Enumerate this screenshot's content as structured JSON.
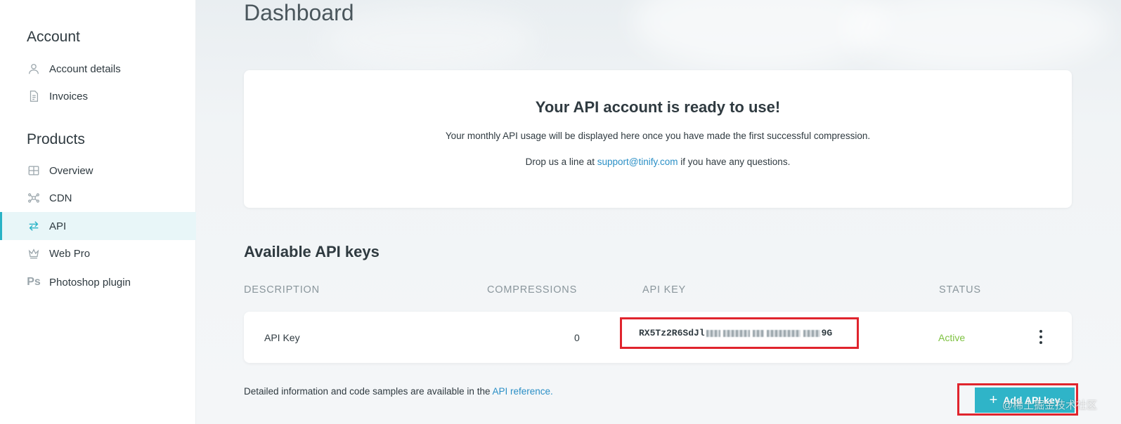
{
  "sidebar": {
    "account_heading": "Account",
    "account_items": [
      {
        "label": "Account details",
        "icon": "user-icon"
      },
      {
        "label": "Invoices",
        "icon": "document-icon"
      }
    ],
    "products_heading": "Products",
    "product_items": [
      {
        "label": "Overview",
        "icon": "grid-icon"
      },
      {
        "label": "CDN",
        "icon": "network-icon"
      },
      {
        "label": "API",
        "icon": "arrows-exchange-icon",
        "active": true
      },
      {
        "label": "Web Pro",
        "icon": "crown-icon"
      },
      {
        "label": "Photoshop plugin",
        "icon": "photoshop-icon",
        "icon_text": "Ps"
      }
    ]
  },
  "main": {
    "page_title": "Dashboard",
    "card": {
      "title": "Your API account is ready to use!",
      "line1": "Your monthly API usage will be displayed here once you have made the first successful compression.",
      "line2_prefix": "Drop us a line at ",
      "line2_link": "support@tinify.com",
      "line2_suffix": " if you have any questions."
    },
    "keys_title": "Available API keys",
    "columns": {
      "description": "DESCRIPTION",
      "compressions": "COMPRESSIONS",
      "api_key": "API KEY",
      "status": "STATUS"
    },
    "keys": [
      {
        "description": "API Key",
        "compressions": "0",
        "key_prefix": "RX5Tz2R6SdJl",
        "key_suffix": "9G",
        "status": "Active"
      }
    ],
    "footer_prefix": "Detailed information and code samples are available in the ",
    "footer_link": "API reference.",
    "add_button": "Add API key",
    "watermark": "@稀土掘金技术社区"
  },
  "colors": {
    "accent": "#2fb4c8",
    "link": "#2a8fc6",
    "status_active": "#7ec241",
    "highlight_box": "#e0242d"
  }
}
